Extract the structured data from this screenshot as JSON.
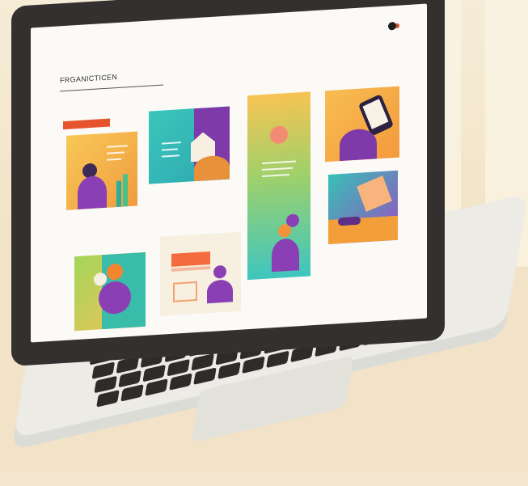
{
  "screen": {
    "site_title": "FRGANICTICEN",
    "colors": {
      "accent": "#e6542e",
      "teal": "#32bfb7",
      "purple": "#8b3fb6",
      "orange": "#f5a142",
      "yellow": "#f4c15a",
      "green": "#8fc94c"
    }
  },
  "keyboard": {
    "rows": 6
  }
}
